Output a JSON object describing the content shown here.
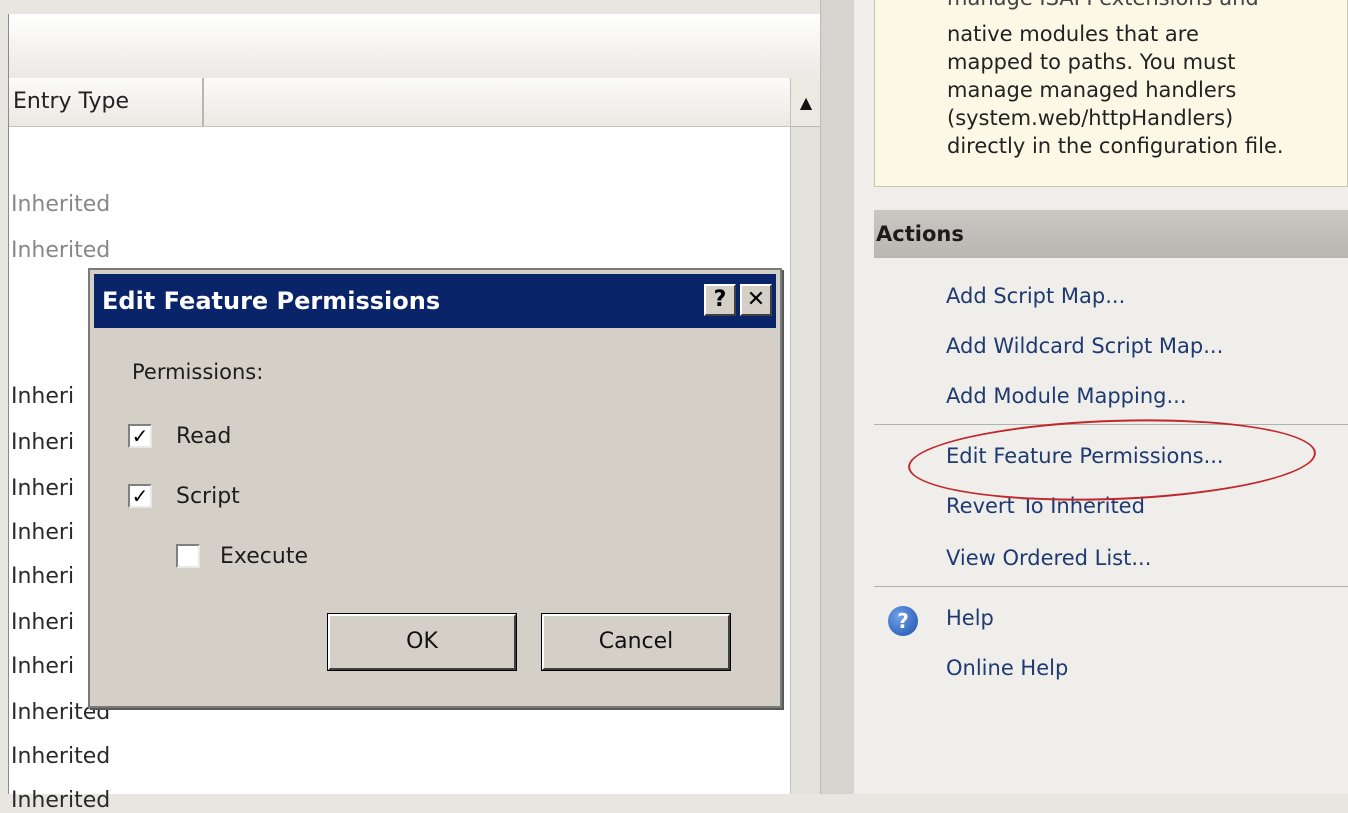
{
  "grid": {
    "column_header": "Entry Type",
    "rows": [
      "Inherited",
      "Inherited",
      "Inheri",
      "Inheri",
      "Inheri",
      "Inheri",
      "Inheri",
      "Inheri",
      "Inheri",
      "Inherited",
      "Inherited",
      "Inherited"
    ],
    "scroll_up_glyph": "▲"
  },
  "info": {
    "clipped_line": "manage ISAPI extensions and",
    "text_lines": [
      "native modules that are",
      "mapped to paths. You must",
      "manage managed handlers",
      "(system.web/httpHandlers)",
      "directly in the configuration file."
    ]
  },
  "actions": {
    "header": "Actions",
    "items": [
      "Add Script Map...",
      "Add Wildcard Script Map...",
      "Add Module Mapping...",
      "Edit Feature Permissions...",
      "Revert To Inherited",
      "View Ordered List..."
    ],
    "help": "Help",
    "online_help": "Online Help"
  },
  "dialog": {
    "title": "Edit Feature Permissions",
    "help_button": "?",
    "close_button": "✕",
    "permissions_label": "Permissions:",
    "checkboxes": [
      {
        "label": "Read",
        "checked": true
      },
      {
        "label": "Script",
        "checked": true
      },
      {
        "label": "Execute",
        "checked": false
      }
    ],
    "ok_label": "OK",
    "cancel_label": "Cancel"
  },
  "colors": {
    "title_bar": "#0a246a",
    "highlight_ellipse": "#c1272d",
    "info_background": "#fbf9e6"
  }
}
